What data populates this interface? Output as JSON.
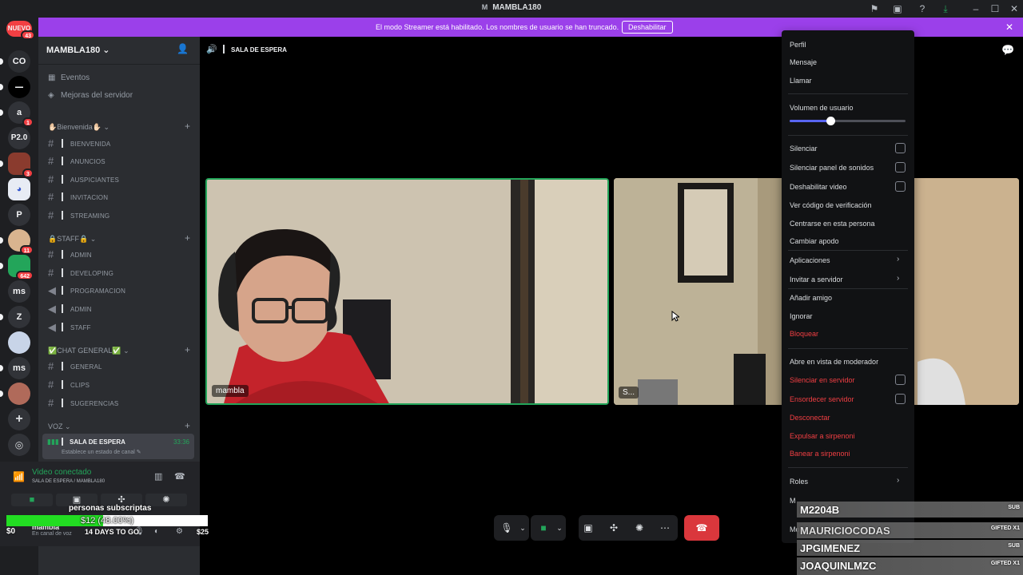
{
  "window": {
    "title": "MAMBLA180",
    "title_letter": "M"
  },
  "banner": {
    "text": "El modo Streamer está habilitado. Los nombres de usuario se han truncado.",
    "button": "Deshabilitar"
  },
  "rail": {
    "items": [
      {
        "label": "NUEVO",
        "badge": "43"
      },
      {
        "label": "CO",
        "badge": ""
      },
      {
        "label": "",
        "badge": ""
      },
      {
        "label": "a",
        "badge": "1"
      },
      {
        "label": "P2.0",
        "badge": ""
      },
      {
        "label": "",
        "badge": "3"
      },
      {
        "label": "",
        "badge": ""
      },
      {
        "label": "P",
        "badge": ""
      },
      {
        "label": "",
        "badge": "11"
      },
      {
        "label": "",
        "badge": "642"
      },
      {
        "label": "ms",
        "badge": ""
      },
      {
        "label": "Z",
        "badge": ""
      },
      {
        "label": "",
        "badge": ""
      },
      {
        "label": "ms",
        "badge": ""
      },
      {
        "label": "",
        "badge": ""
      }
    ]
  },
  "sidebar": {
    "server_name": "MAMBLA180",
    "extras": [
      "Eventos",
      "Mejoras del servidor"
    ],
    "categories": [
      {
        "name": "✋🏻Bienvenida✋🏻",
        "channels": [
          "BIENVENIDA",
          "ANUNCIOS",
          "AUSPICIANTES",
          "INVITACION",
          "STREAMING"
        ]
      },
      {
        "name": "🔒STAFF🔒",
        "channels": [
          "ADMIN",
          "DEVELOPING",
          "PROGRAMACION",
          "ADMIN",
          "STAFF"
        ]
      },
      {
        "name": "✅CHAT GENERAL✅",
        "channels": [
          "GENERAL",
          "CLIPS",
          "SUGERENCIAS"
        ]
      }
    ],
    "voice_category": "VOZ",
    "voice_channel": {
      "name": "SALA DE ESPERA",
      "time": "33:36",
      "status": "Establece un estado de canal"
    }
  },
  "voice_panel": {
    "status": "Video conectado",
    "location": "SALA DE ESPERA / MAMBLA180"
  },
  "user": {
    "name": "mambla",
    "status": "En canal de voz"
  },
  "sub_goal": {
    "label": "personas subscriptas",
    "text": "$12 (48.00%)",
    "progress": 0.48,
    "left": "$0",
    "days": "14 DAYS TO GO",
    "right": "$25"
  },
  "call": {
    "channel": "SALA DE ESPERA",
    "tiles": [
      {
        "name": "mambla"
      },
      {
        "name": "S..."
      }
    ]
  },
  "menu": {
    "items_top": [
      "Perfil",
      "Mensaje",
      "Llamar"
    ],
    "volume_label": "Volumen de usuario",
    "volume": 0.35,
    "checks": [
      "Silenciar",
      "Silenciar panel de sonidos",
      "Deshabilitar video"
    ],
    "actions": [
      "Ver código de verificación",
      "Centrarse en esta persona",
      "Cambiar apodo"
    ],
    "submenus": [
      "Aplicaciones",
      "Invitar a servidor"
    ],
    "actions2": [
      "Añadir amigo",
      "Ignorar"
    ],
    "block": "Bloquear",
    "mod_view": "Abre en vista de moderador",
    "mod_checks": [
      "Silenciar en servidor",
      "Ensordecer servidor"
    ],
    "mod_red": [
      "Desconectar",
      "Expulsar a sirpenoni",
      "Banear a sirpenoni"
    ],
    "roles": "Roles",
    "m1": "M",
    "m2": "Mo"
  },
  "gifted": [
    {
      "name": "M2204B",
      "kind": "SUB"
    },
    {
      "name": "MAURICIOCODAS",
      "kind": "GIFTED X1"
    },
    {
      "name": "JPGIMENEZ",
      "kind": "SUB"
    },
    {
      "name": "JOAQUINLMZC",
      "kind": "GIFTED X1"
    }
  ]
}
